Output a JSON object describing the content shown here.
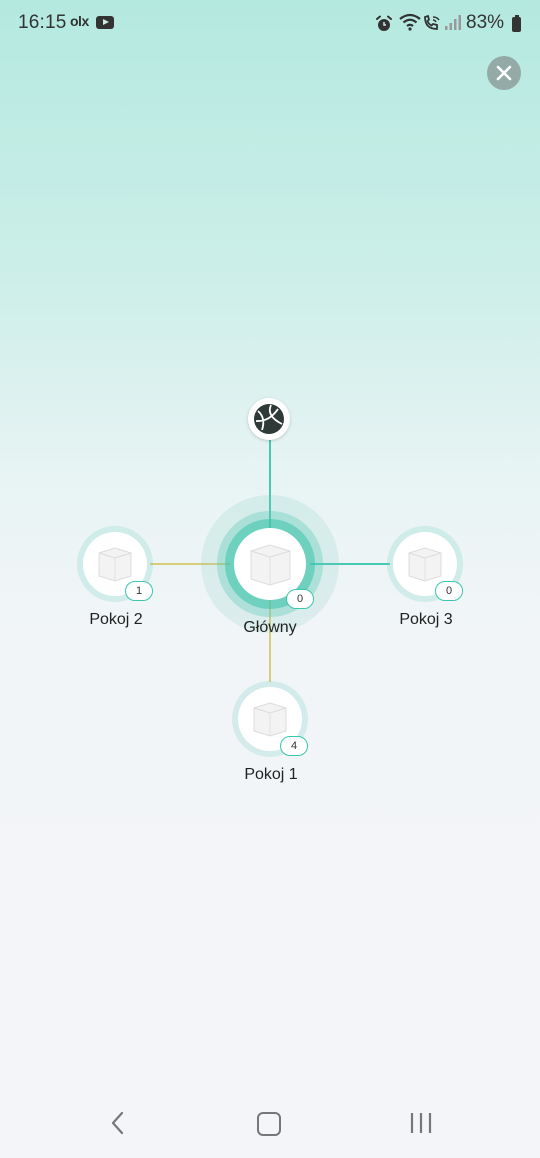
{
  "status_bar": {
    "time": "16:15",
    "notification_icons": [
      "olx-icon",
      "youtube-icon"
    ],
    "system_icons": [
      "alarm-icon",
      "wifi-icon",
      "wifi-call-icon",
      "signal-icon"
    ],
    "battery_percent": "83%"
  },
  "header": {
    "close_icon": "close-icon"
  },
  "topology": {
    "internet": {
      "icon": "globe-icon"
    },
    "main_node": {
      "label": "Główny",
      "clients": "0"
    },
    "nodes": [
      {
        "id": "pokoj2",
        "label": "Pokoj 2",
        "clients": "1"
      },
      {
        "id": "pokoj3",
        "label": "Pokoj 3",
        "clients": "0"
      },
      {
        "id": "pokoj1",
        "label": "Pokoj 1",
        "clients": "4"
      }
    ],
    "colors": {
      "strong_link": "#45c9b3",
      "weak_link": "#d9cc7a",
      "badge_border": "#3cc6ae"
    }
  },
  "nav_bar": {
    "back": "back-icon",
    "home": "home-icon",
    "recents": "recents-icon"
  }
}
